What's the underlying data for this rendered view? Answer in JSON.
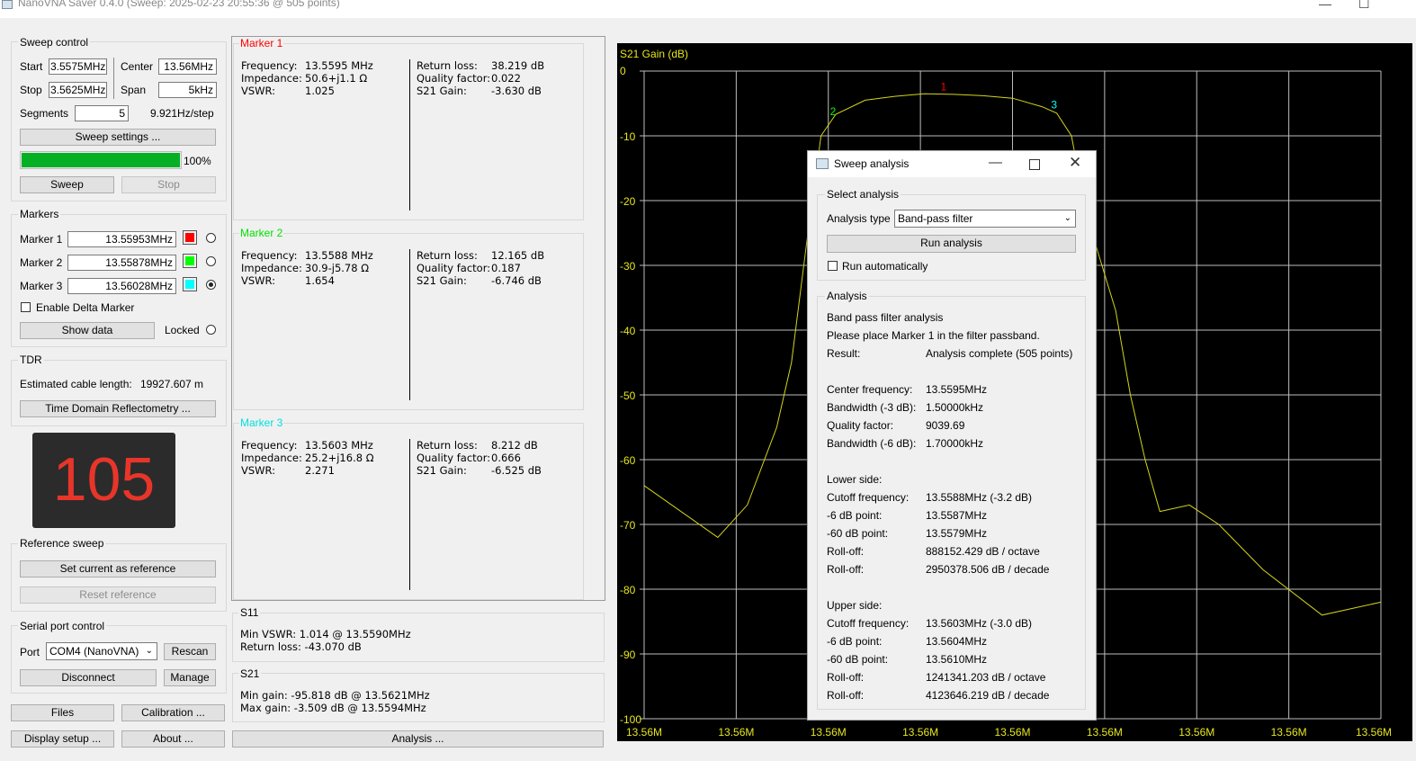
{
  "window": {
    "title": "NanoVNA Saver 0.4.0 (Sweep: 2025-02-23 20:55:36 @ 505 points)",
    "min": "—",
    "max": "☐"
  },
  "sweep_control": {
    "title": "Sweep control",
    "start_label": "Start",
    "start_value": "3.5575MHz",
    "center_label": "Center",
    "center_value": "13.56MHz",
    "stop_label": "Stop",
    "stop_value": "3.5625MHz",
    "span_label": "Span",
    "span_value": "5kHz",
    "segments_label": "Segments",
    "segments_value": "5",
    "step": "9.921Hz/step",
    "settings_button": "Sweep settings ...",
    "progress": 100,
    "progress_text": "100%",
    "sweep_button": "Sweep",
    "stop_button": "Stop"
  },
  "markers": {
    "title": "Markers",
    "items": [
      {
        "label": "Marker 1",
        "value": "13.55953MHz",
        "color": "#ff0000",
        "selected": false
      },
      {
        "label": "Marker 2",
        "value": "13.55878MHz",
        "color": "#00ff00",
        "selected": false
      },
      {
        "label": "Marker 3",
        "value": "13.56028MHz",
        "color": "#00ffff",
        "selected": true
      }
    ],
    "delta_label": "Enable Delta Marker",
    "show_data_button": "Show data",
    "locked_label": "Locked"
  },
  "tdr": {
    "title": "TDR",
    "cable_label": "Estimated cable length:",
    "cable_value": "19927.607 m",
    "button": "Time Domain Reflectometry ..."
  },
  "big_display": {
    "value": "105",
    "color": "#e8352a"
  },
  "reference": {
    "title": "Reference sweep",
    "set_button": "Set current as reference",
    "reset_button": "Reset reference"
  },
  "serial": {
    "title": "Serial port control",
    "port_label": "Port",
    "port_value": "COM4 (NanoVNA)",
    "rescan_button": "Rescan",
    "disconnect_button": "Disconnect",
    "manage_button": "Manage"
  },
  "bottom_buttons": {
    "files": "Files",
    "calibration": "Calibration ...",
    "display_setup": "Display setup ...",
    "about": "About ...",
    "analysis": "Analysis ..."
  },
  "marker_panels": [
    {
      "title": "Marker 1",
      "title_color": "#ff0000",
      "left": [
        [
          "Frequency:",
          "13.5595 MHz"
        ],
        [
          "Impedance:",
          "50.6+j1.1 Ω"
        ],
        [
          "VSWR:",
          "1.025"
        ]
      ],
      "right": [
        [
          "Return loss:",
          "38.219 dB"
        ],
        [
          "Quality factor:",
          "0.022"
        ],
        [
          "S21 Gain:",
          "-3.630 dB"
        ]
      ]
    },
    {
      "title": "Marker 2",
      "title_color": "#00e000",
      "left": [
        [
          "Frequency:",
          "13.5588 MHz"
        ],
        [
          "Impedance:",
          "30.9-j5.78 Ω"
        ],
        [
          "VSWR:",
          "1.654"
        ]
      ],
      "right": [
        [
          "Return loss:",
          "12.165 dB"
        ],
        [
          "Quality factor:",
          "0.187"
        ],
        [
          "S21 Gain:",
          "-6.746 dB"
        ]
      ]
    },
    {
      "title": "Marker 3",
      "title_color": "#00e0e0",
      "left": [
        [
          "Frequency:",
          "13.5603 MHz"
        ],
        [
          "Impedance:",
          "25.2+j16.8 Ω"
        ],
        [
          "VSWR:",
          "2.271"
        ]
      ],
      "right": [
        [
          "Return loss:",
          "8.212 dB"
        ],
        [
          "Quality factor:",
          "0.666"
        ],
        [
          "S21 Gain:",
          "-6.525 dB"
        ]
      ]
    }
  ],
  "s11": {
    "title": "S11",
    "min_vswr": "Min VSWR:  1.014 @ 13.5590MHz",
    "return_loss": "Return loss: -43.070 dB"
  },
  "s21": {
    "title": "S21",
    "min_gain": "Min gain:  -95.818 dB @ 13.5621MHz",
    "max_gain": "Max gain: -3.509 dB @ 13.5594MHz"
  },
  "chart_data": {
    "type": "line",
    "title": "S21 Gain (dB)",
    "ylim": [
      -100,
      0
    ],
    "y_ticks": [
      "0",
      "-10",
      "-20",
      "-30",
      "-40",
      "-50",
      "-60",
      "-70",
      "-80",
      "-90",
      "-100"
    ],
    "x_ticks": [
      "13.56M",
      "13.56M",
      "13.56M",
      "13.56M",
      "13.56M",
      "13.56M",
      "13.56M",
      "13.56M",
      "13.56M"
    ],
    "xlim_mhz": [
      13.5575,
      13.5625
    ],
    "grid": true,
    "trace_color": "#d4d41a",
    "series": [
      {
        "x": [
          13.5575,
          13.558,
          13.5582,
          13.5584,
          13.5585,
          13.5586,
          13.5587,
          13.5588,
          13.559,
          13.5592,
          13.5594,
          13.5596,
          13.5598,
          13.56,
          13.5602,
          13.5603,
          13.5604,
          13.5605,
          13.5607,
          13.5608,
          13.5609,
          13.561,
          13.5612,
          13.5614,
          13.5617,
          13.5621,
          13.5625
        ],
        "y": [
          -64,
          -72,
          -67,
          -55,
          -45,
          -27,
          -10,
          -6.7,
          -4.5,
          -3.9,
          -3.5,
          -3.6,
          -3.8,
          -4.2,
          -5.5,
          -6.5,
          -10,
          -22,
          -37,
          -50,
          -60,
          -68,
          -67,
          -70,
          -77,
          -84,
          -82
        ]
      }
    ],
    "markers": [
      {
        "label": "1",
        "x": 13.55953,
        "color": "#ff0000"
      },
      {
        "label": "2",
        "x": 13.55878,
        "color": "#00ff00"
      },
      {
        "label": "3",
        "x": 13.56028,
        "color": "#00ffff"
      }
    ]
  },
  "dialog": {
    "title": "Sweep analysis",
    "select_title": "Select analysis",
    "type_label": "Analysis type",
    "type_value": "Band-pass filter",
    "run_button": "Run analysis",
    "auto_label": "Run automatically",
    "analysis_title": "Analysis",
    "rows": [
      [
        "Band pass filter analysis",
        ""
      ],
      [
        "Please place Marker 1 in the filter passband.",
        ""
      ],
      [
        "Result:",
        "Analysis complete (505 points)"
      ],
      [
        "",
        ""
      ],
      [
        "Center frequency:",
        "13.5595MHz"
      ],
      [
        "Bandwidth (-3 dB):",
        "1.50000kHz"
      ],
      [
        "Quality factor:",
        "9039.69"
      ],
      [
        "Bandwidth (-6 dB):",
        "1.70000kHz"
      ],
      [
        "",
        ""
      ],
      [
        "Lower side:",
        ""
      ],
      [
        "Cutoff frequency:",
        "13.5588MHz (-3.2 dB)"
      ],
      [
        "-6 dB point:",
        "13.5587MHz"
      ],
      [
        "-60 dB point:",
        "13.5579MHz"
      ],
      [
        "Roll-off:",
        "888152.429 dB / octave"
      ],
      [
        "Roll-off:",
        "2950378.506 dB / decade"
      ],
      [
        "",
        ""
      ],
      [
        "Upper side:",
        ""
      ],
      [
        "Cutoff frequency:",
        "13.5603MHz (-3.0 dB)"
      ],
      [
        "-6 dB point:",
        "13.5604MHz"
      ],
      [
        "-60 dB point:",
        "13.5610MHz"
      ],
      [
        "Roll-off:",
        "1241341.203 dB / octave"
      ],
      [
        "Roll-off:",
        "4123646.219 dB / decade"
      ]
    ]
  }
}
